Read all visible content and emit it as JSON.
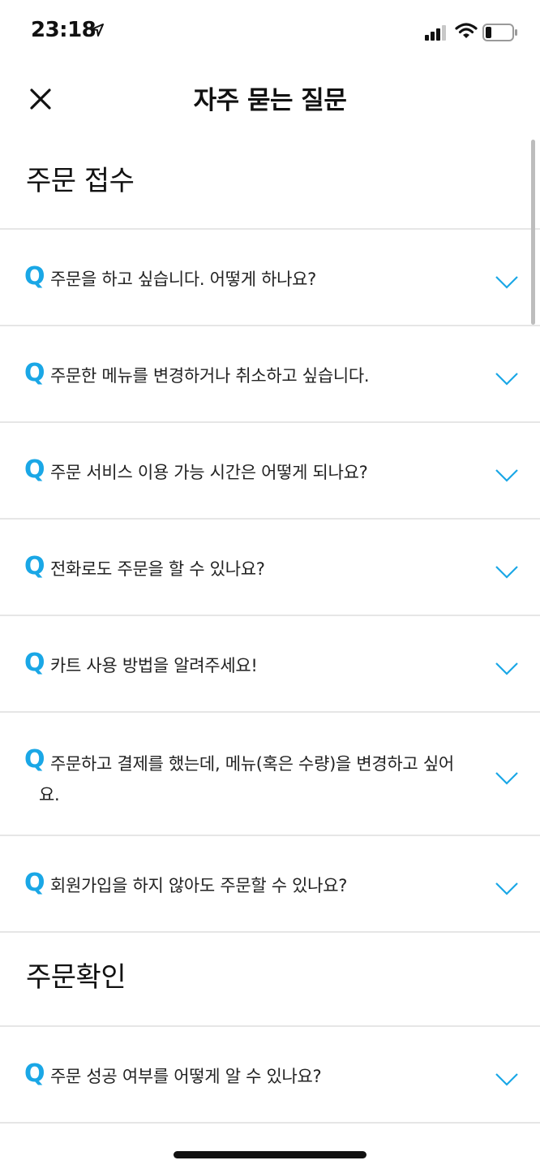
{
  "status": {
    "time": "23:18"
  },
  "header": {
    "title": "자주 묻는 질문"
  },
  "q_marker": "Q",
  "sections": [
    {
      "title": "주문 접수",
      "items": [
        "주문을 하고 싶습니다. 어떻게 하나요?",
        "주문한 메뉴를 변경하거나 취소하고 싶습니다.",
        "주문 서비스 이용 가능 시간은 어떻게 되나요?",
        "전화로도 주문을 할 수 있나요?",
        "카트 사용 방법을 알려주세요!",
        "주문하고 결제를 했는데, 메뉴(혹은 수량)을 변경하고 싶어요.",
        "회원가입을 하지 않아도 주문할 수 있나요?"
      ]
    },
    {
      "title": "주문확인",
      "items": [
        "주문 성공 여부를 어떻게 알 수 있나요?"
      ]
    }
  ],
  "colors": {
    "accent": "#1aa7e6",
    "divider": "#e6e6e6"
  },
  "icons": [
    "location-arrow-icon",
    "signal-icon",
    "wifi-icon",
    "battery-icon",
    "close-icon",
    "chevron-down-icon"
  ]
}
